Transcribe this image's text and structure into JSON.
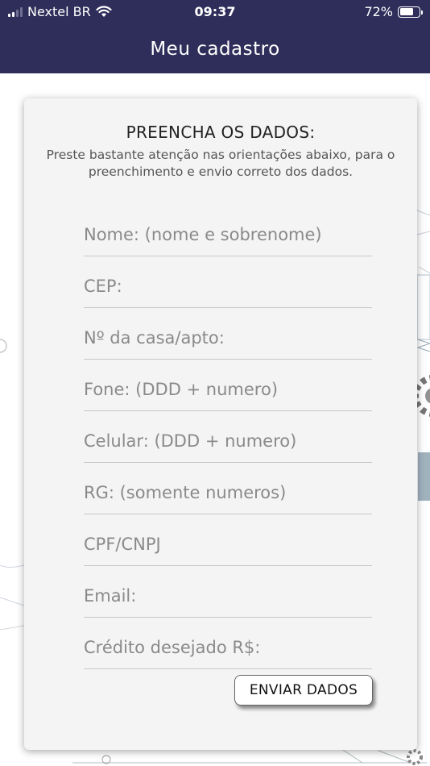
{
  "status_bar": {
    "carrier": "Nextel BR",
    "time": "09:37",
    "battery": "72%",
    "battery_level": 0.72,
    "signal_icon": "signal-bars-icon",
    "wifi_icon": "wifi-icon",
    "battery_icon": "battery-icon"
  },
  "nav": {
    "title": "Meu cadastro"
  },
  "form": {
    "heading": "PREENCHA OS DADOS:",
    "subheading": "Preste bastante atenção nas orientações abaixo, para o preenchimento e envio correto dos dados.",
    "fields": [
      {
        "placeholder": "Nome: (nome e sobrenome)",
        "value": ""
      },
      {
        "placeholder": "CEP:",
        "value": ""
      },
      {
        "placeholder": "Nº da casa/apto:",
        "value": ""
      },
      {
        "placeholder": "Fone: (DDD + numero)",
        "value": ""
      },
      {
        "placeholder": "Celular: (DDD + numero)",
        "value": ""
      },
      {
        "placeholder": "RG: (somente numeros)",
        "value": ""
      },
      {
        "placeholder": "CPF/CNPJ",
        "value": ""
      },
      {
        "placeholder": "Email:",
        "value": ""
      },
      {
        "placeholder": "Crédito desejado R$:",
        "value": ""
      }
    ],
    "submit_label": "ENVIAR DADOS"
  },
  "colors": {
    "header_bg": "#2f2e5a",
    "card_bg": "#f4f4f4",
    "divider": "#c8c8c8"
  }
}
